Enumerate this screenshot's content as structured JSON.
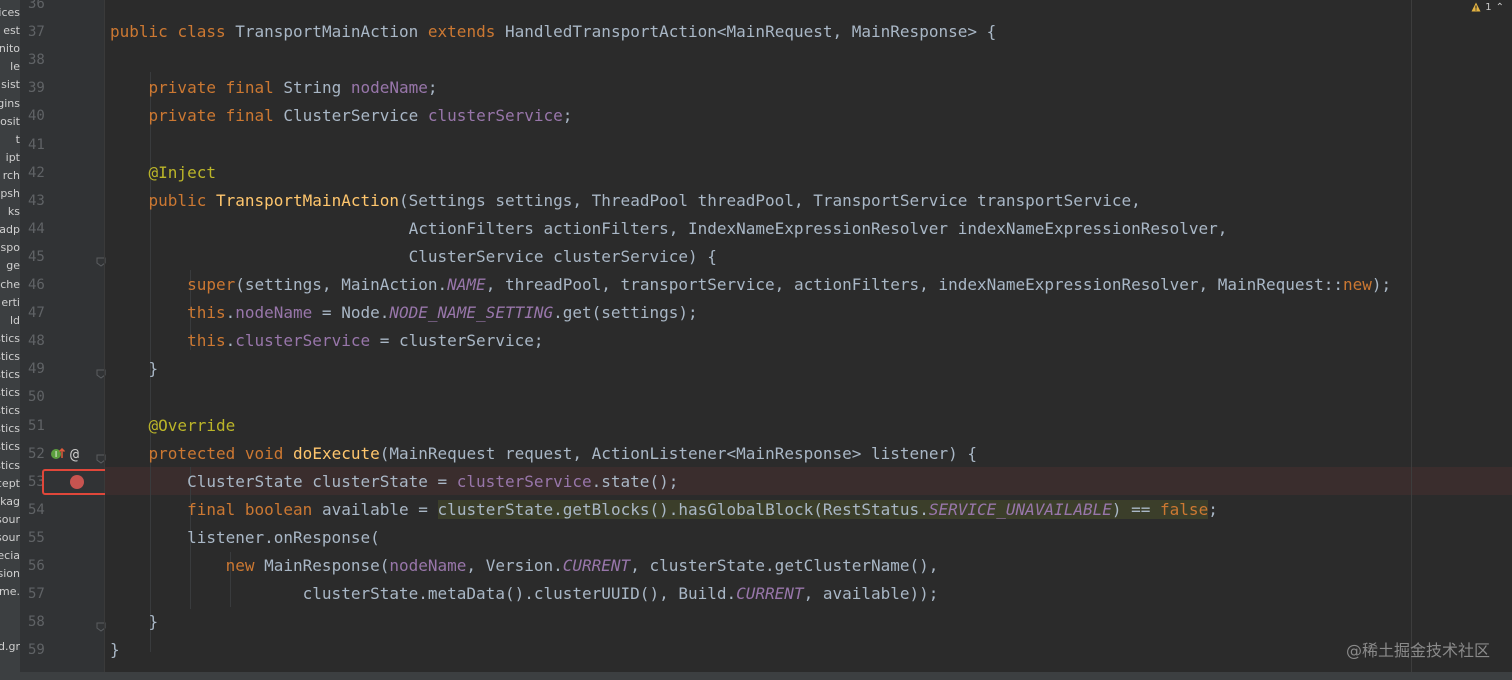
{
  "project_tree": {
    "items": [
      "ices",
      "est",
      "nito",
      "le",
      "sist",
      "gins",
      "osit",
      "t",
      "ipt",
      "rch",
      "psh",
      "ks",
      "eadp",
      "nspo",
      "ge",
      "tche",
      "erti",
      "ld",
      "stics",
      "stics",
      "stics",
      "stics",
      "stics",
      "stics",
      "stics",
      "stics",
      "cept",
      "kag",
      "sour",
      "sour",
      "ecia",
      "sion",
      "me.",
      "",
      "",
      "d.gr"
    ]
  },
  "editor": {
    "lines": [
      {
        "num": "36",
        "text": ""
      },
      {
        "num": "37",
        "text": "public class TransportMainAction extends HandledTransportAction<MainRequest, MainResponse> {"
      },
      {
        "num": "38",
        "text": ""
      },
      {
        "num": "39",
        "text": "    private final String nodeName;"
      },
      {
        "num": "40",
        "text": "    private final ClusterService clusterService;"
      },
      {
        "num": "41",
        "text": ""
      },
      {
        "num": "42",
        "text": "    @Inject"
      },
      {
        "num": "43",
        "text": "    public TransportMainAction(Settings settings, ThreadPool threadPool, TransportService transportService,"
      },
      {
        "num": "44",
        "text": "                               ActionFilters actionFilters, IndexNameExpressionResolver indexNameExpressionResolver,"
      },
      {
        "num": "45",
        "text": "                               ClusterService clusterService) {"
      },
      {
        "num": "46",
        "text": "        super(settings, MainAction.NAME, threadPool, transportService, actionFilters, indexNameExpressionResolver, MainRequest::new);"
      },
      {
        "num": "47",
        "text": "        this.nodeName = Node.NODE_NAME_SETTING.get(settings);"
      },
      {
        "num": "48",
        "text": "        this.clusterService = clusterService;"
      },
      {
        "num": "49",
        "text": "    }"
      },
      {
        "num": "50",
        "text": ""
      },
      {
        "num": "51",
        "text": "    @Override"
      },
      {
        "num": "52",
        "text": "    protected void doExecute(MainRequest request, ActionListener<MainResponse> listener) {"
      },
      {
        "num": "53",
        "text": "        ClusterState clusterState = clusterService.state();"
      },
      {
        "num": "54",
        "text": "        final boolean available = clusterState.getBlocks().hasGlobalBlock(RestStatus.SERVICE_UNAVAILABLE) == false;"
      },
      {
        "num": "55",
        "text": "        listener.onResponse("
      },
      {
        "num": "56",
        "text": "            new MainResponse(nodeName, Version.CURRENT, clusterState.getClusterName(),"
      },
      {
        "num": "57",
        "text": "                    clusterState.metaData().clusterUUID(), Build.CURRENT, available));"
      },
      {
        "num": "58",
        "text": "    }"
      },
      {
        "num": "59",
        "text": "}"
      }
    ]
  },
  "gutter": {
    "implements_icon": "implements-marker-icon",
    "override_icon": "override-at-icon",
    "override_symbol": "@",
    "breakpoint_line": "53",
    "breakpoint_color": "#c75450"
  },
  "inspections": {
    "warning_icon": "warning-triangle-icon",
    "warning_count": "1",
    "up_arrow": "⌃"
  },
  "watermark": {
    "text": "@稀土掘金技术社区"
  },
  "colors": {
    "editor_bg": "#2b2b2b",
    "gutter_bg": "#313335",
    "keyword": "#cc7832",
    "field": "#9876aa",
    "method": "#ffc66d",
    "annotation": "#bbb529",
    "text": "#a9b7c6",
    "highlight_box": "#e0473a"
  }
}
